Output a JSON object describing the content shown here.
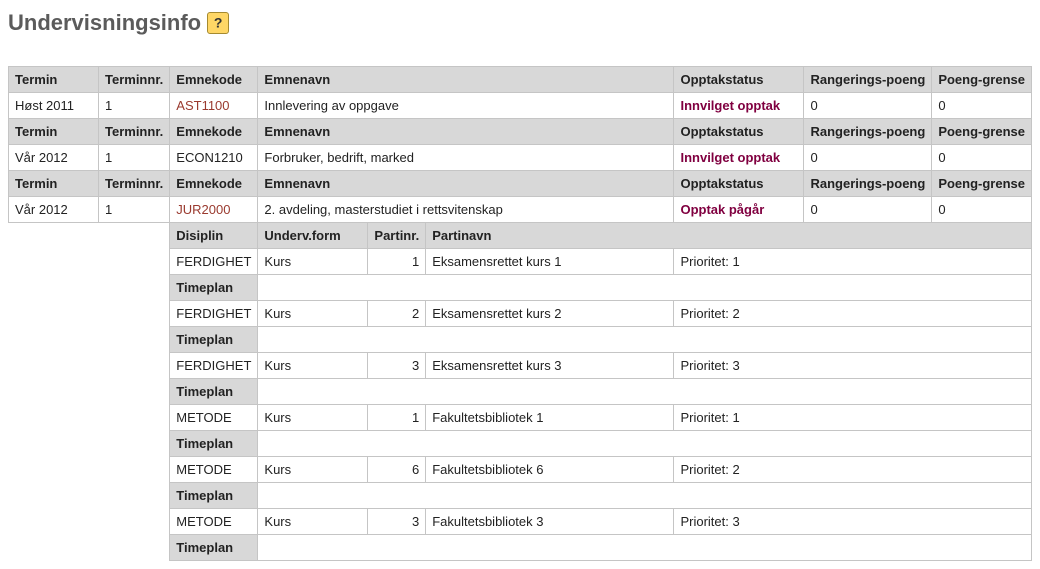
{
  "title": "Undervisningsinfo",
  "headers": {
    "termin": "Termin",
    "terminnr": "Terminnr.",
    "emnekode": "Emnekode",
    "emnenavn": "Emnenavn",
    "opptakstatus": "Opptakstatus",
    "rangeringspoeng": "Rangerings-poeng",
    "poenggrense": "Poeng-grense"
  },
  "sub_headers": {
    "disiplin": "Disiplin",
    "undervform": "Underv.form",
    "partinr": "Partinr.",
    "partinavn": "Partinavn"
  },
  "timeplan_label": "Timeplan",
  "prioritet_prefix": "Prioritet: ",
  "rows": {
    "r1": {
      "termin": "Høst 2011",
      "terminnr": "1",
      "emnekode": "AST1100",
      "emnenavn": "Innlevering av oppgave",
      "status": "Innvilget opptak",
      "poeng": "0",
      "grense": "0"
    },
    "r2": {
      "termin": "Vår 2012",
      "terminnr": "1",
      "emnekode": "ECON1210",
      "emnenavn": "Forbruker, bedrift, marked",
      "status": "Innvilget opptak",
      "poeng": "0",
      "grense": "0"
    },
    "r3": {
      "termin": "Vår 2012",
      "terminnr": "1",
      "emnekode": "JUR2000",
      "emnenavn": "2. avdeling, masterstudiet i rettsvitenskap",
      "status": "Opptak pågår",
      "poeng": "0",
      "grense": "0"
    }
  },
  "parts": {
    "p1": {
      "disiplin": "FERDIGHET",
      "form": "Kurs",
      "nr": "1",
      "navn": "Eksamensrettet kurs 1",
      "pri": "1"
    },
    "p2": {
      "disiplin": "FERDIGHET",
      "form": "Kurs",
      "nr": "2",
      "navn": "Eksamensrettet kurs 2",
      "pri": "2"
    },
    "p3": {
      "disiplin": "FERDIGHET",
      "form": "Kurs",
      "nr": "3",
      "navn": "Eksamensrettet kurs 3",
      "pri": "3"
    },
    "p4": {
      "disiplin": "METODE",
      "form": "Kurs",
      "nr": "1",
      "navn": "Fakultetsbibliotek 1",
      "pri": "1"
    },
    "p5": {
      "disiplin": "METODE",
      "form": "Kurs",
      "nr": "6",
      "navn": "Fakultetsbibliotek 6",
      "pri": "2"
    },
    "p6": {
      "disiplin": "METODE",
      "form": "Kurs",
      "nr": "3",
      "navn": "Fakultetsbibliotek 3",
      "pri": "3"
    }
  }
}
